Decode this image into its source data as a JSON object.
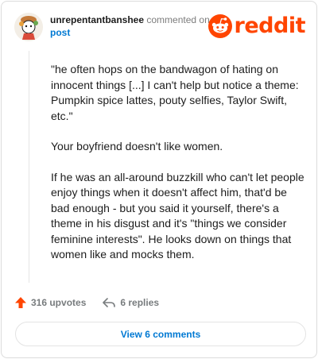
{
  "comment": {
    "username": "unrepentantbanshee",
    "action_text": "commented on",
    "target_link": "post",
    "brand": "reddit",
    "paragraphs": [
      "\"he often hops on the bandwagon of hating on innocent things [...] I can't help but notice a theme: Pumpkin spice lattes, pouty selfies, Taylor Swift, etc.\"",
      "Your boyfriend doesn't like women.",
      "If he was an all-around buzzkill who can't let people enjoy things when it doesn't affect him, that'd be bad enough - but you said it yourself, there's a theme in his disgust and it's \"things we consider feminine interests\". He looks down on things that women like and mocks them."
    ]
  },
  "actions": {
    "upvotes": "316 upvotes",
    "replies": "6 replies"
  },
  "footer": {
    "view_comments_label": "View 6 comments"
  },
  "icons": {
    "avatar": "avatar-icon",
    "reddit_logo": "reddit-logo-icon",
    "upvote": "upvote-arrow-icon",
    "reply": "reply-arrow-icon"
  },
  "colors": {
    "brand_orange": "#ff4500",
    "link_blue": "#0079d3",
    "upvote_orange": "#ff4500",
    "muted_gray": "#787c7e"
  }
}
